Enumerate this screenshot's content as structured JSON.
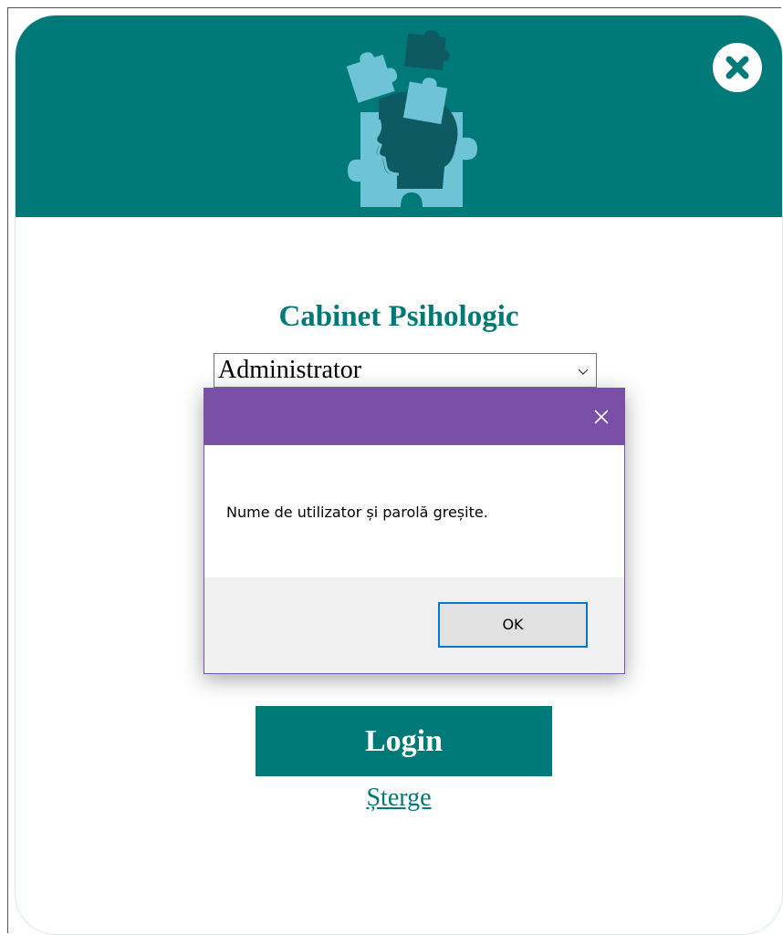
{
  "app": {
    "title": "Cabinet Psihologic"
  },
  "header": {
    "logo_icon": "puzzle-head-icon",
    "close_icon": "close-circle-icon"
  },
  "login_form": {
    "role_select": {
      "selected_value": "Administrator"
    },
    "login_label": "Login",
    "clear_label": "Șterge"
  },
  "dialog": {
    "message": "Nume de utilizator și parolă greșite.",
    "ok_label": "OK",
    "close_icon": "close-icon"
  },
  "colors": {
    "brand_teal": "#007a78",
    "dialog_purple": "#7a4fa8",
    "logo_light_blue": "#6fc3d6",
    "logo_dark": "#0d5a63",
    "ok_border": "#0078d7"
  }
}
